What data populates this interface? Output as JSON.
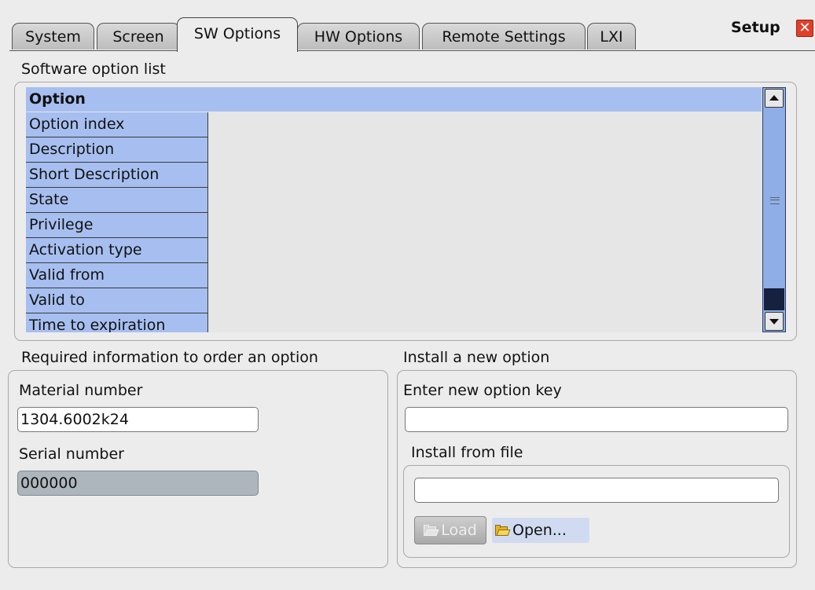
{
  "tabs": [
    {
      "label": "System",
      "active": false
    },
    {
      "label": "Screen",
      "active": false
    },
    {
      "label": "SW Options",
      "active": true
    },
    {
      "label": "HW Options",
      "active": false
    },
    {
      "label": "Remote Settings",
      "active": false
    },
    {
      "label": "LXI",
      "active": false
    }
  ],
  "dialog": {
    "title": "Setup",
    "close_icon": "close-icon"
  },
  "option_list": {
    "section_label": "Software option list",
    "header": "Option",
    "rows": [
      "Option index",
      "Description",
      "Short Description",
      "State",
      "Privilege",
      "Activation type",
      "Valid from",
      "Valid to",
      "Time to expiration"
    ]
  },
  "order_info": {
    "section_label": "Required information to order an option",
    "material_label": "Material number",
    "material_value": "1304.6002k24",
    "serial_label": "Serial number",
    "serial_value": "000000"
  },
  "install": {
    "section_label": "Install a new option",
    "key_label": "Enter new option key",
    "key_value": "",
    "file_label": "Install from file",
    "file_value": "",
    "load_label": "Load",
    "open_label": "Open..."
  },
  "colors": {
    "grid_blue": "#a7bff0",
    "scroll_blue": "#8faee8",
    "close_red": "#e0402a"
  }
}
